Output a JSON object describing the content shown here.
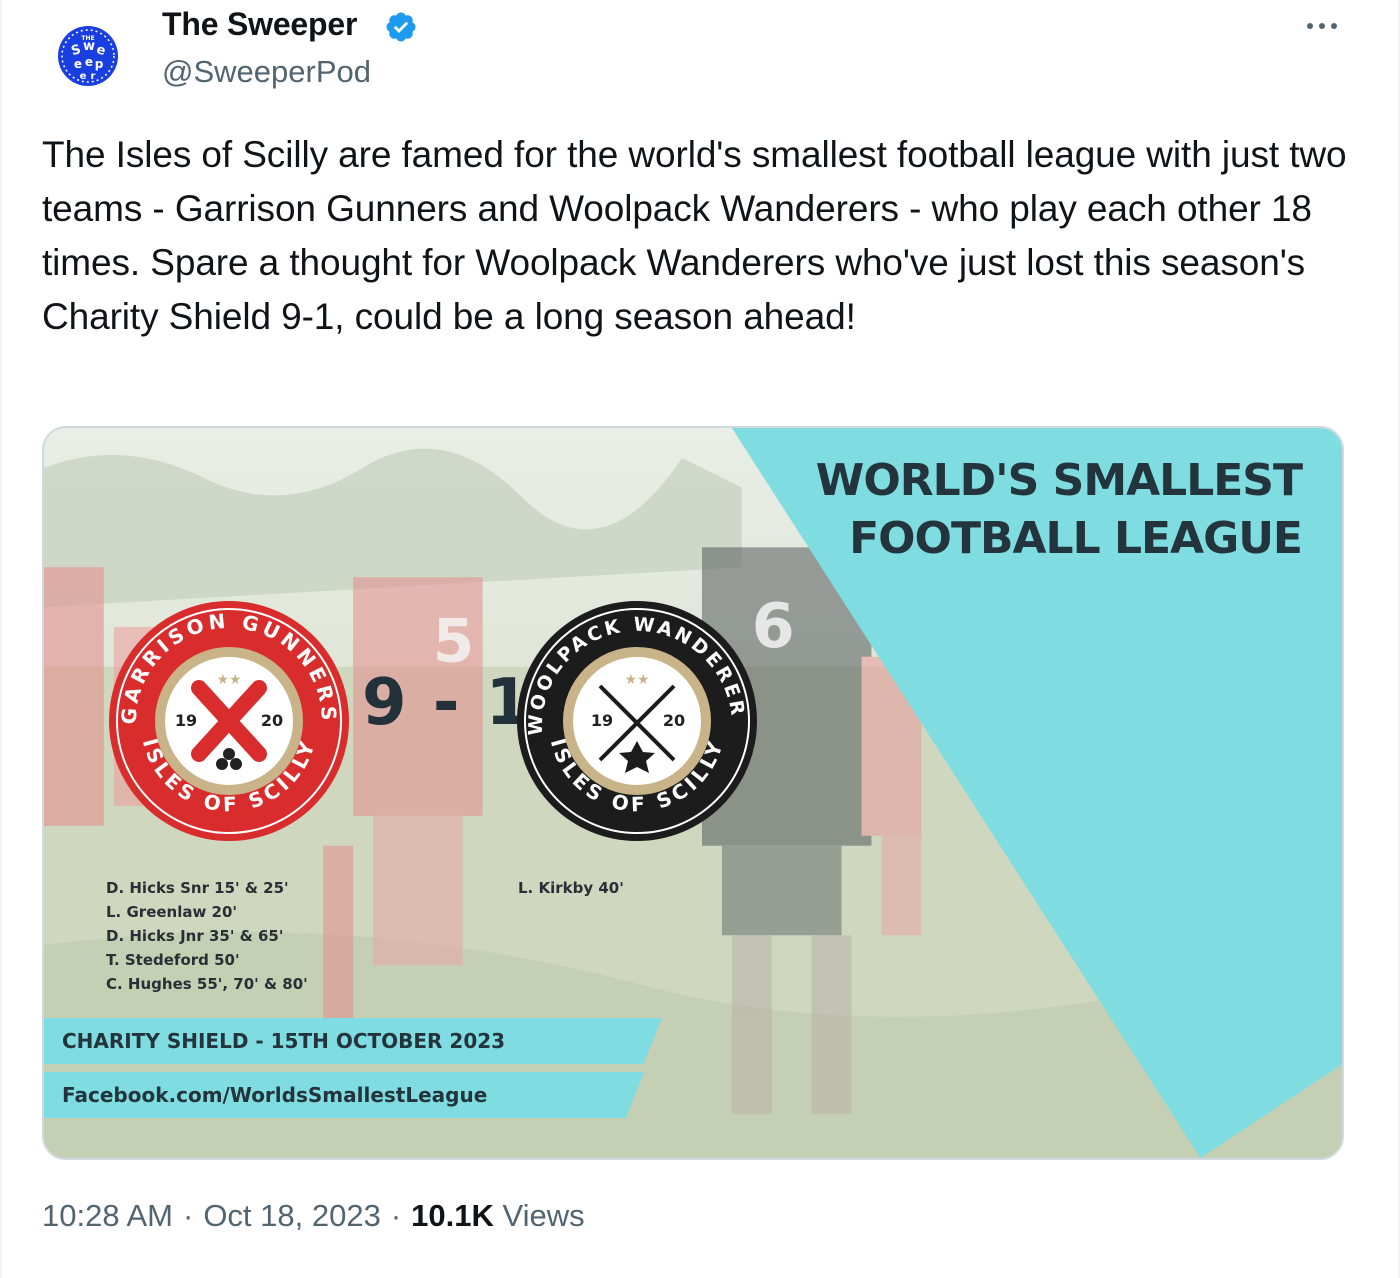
{
  "author": {
    "name": "The Sweeper",
    "handle": "@SweeperPod",
    "avatar_text": "THE SWEEPER"
  },
  "tweet": {
    "text": "The Isles of Scilly are famed for the world's smallest football league with just two teams - Garrison Gunners and Woolpack Wanderers - who play each other 18 times. Spare a thought for Woolpack Wanderers who've just lost this season's Charity Shield 9-1, could be a long season ahead!"
  },
  "media": {
    "headline_line1": "WORLD'S SMALLEST",
    "headline_line2": "FOOTBALL LEAGUE",
    "score": "9 - 1",
    "home_badge": {
      "top_text": "GARRISON GUNNERS",
      "bottom_text": "ISLES OF SCILLY",
      "year_left": "19",
      "year_right": "20",
      "stars": "★★"
    },
    "away_badge": {
      "top_text": "WOOLPACK WANDERERS",
      "bottom_text": "ISLES OF SCILLY",
      "year_left": "19",
      "year_right": "20",
      "stars": "★★"
    },
    "home_scorers": [
      "D. Hicks Snr 15' & 25'",
      "L. Greenlaw 20'",
      "D. Hicks Jnr 35' & 65'",
      "T. Stedeford 50'",
      "C. Hughes 55', 70' & 80'"
    ],
    "away_scorers": [
      "L. Kirkby 40'"
    ],
    "banner_date": "CHARITY SHIELD - 15TH OCTOBER 2023",
    "banner_link": "Facebook.com/WorldsSmallestLeague",
    "jersey_numbers": [
      "5",
      "6"
    ]
  },
  "footer": {
    "time": "10:28 AM",
    "separator": "·",
    "date": "Oct 18, 2023",
    "views_count": "10.1K",
    "views_label": "Views"
  },
  "colors": {
    "text": "#0f1419",
    "secondary": "#536471",
    "verified": "#1d9bf0",
    "accent_teal": "#7fdde2",
    "home_red": "#d92d2d",
    "away_black": "#1c1c1c"
  },
  "icons": [
    "verified-icon",
    "more-icon"
  ]
}
